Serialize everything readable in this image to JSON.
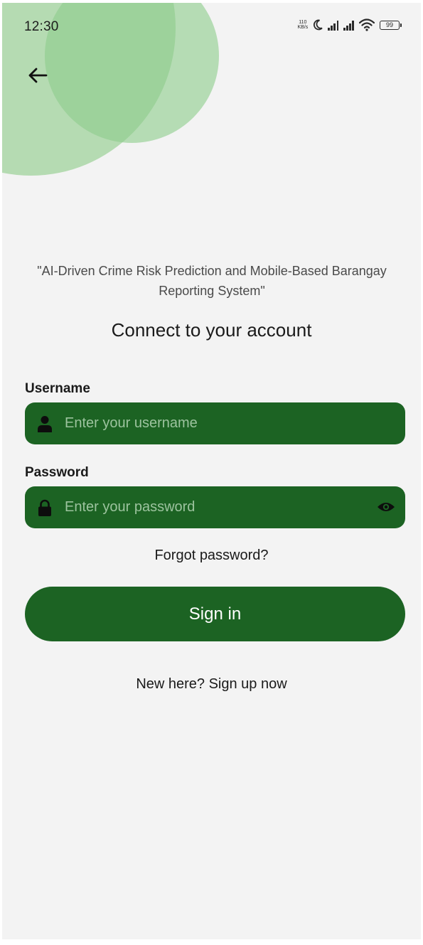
{
  "status_bar": {
    "time": "12:30",
    "network_speed_value": "110",
    "network_speed_unit": "KB/s",
    "battery_level": "99",
    "icons": [
      "moon-icon",
      "signal-icon",
      "signal-icon",
      "wifi-icon",
      "battery-icon"
    ]
  },
  "header": {
    "back_icon": "arrow-left-icon"
  },
  "tagline": "\"AI-Driven Crime Risk Prediction and Mobile-Based Barangay Reporting System\"",
  "title": "Connect to your account",
  "form": {
    "username": {
      "label": "Username",
      "placeholder": "Enter your username",
      "value": "",
      "icon": "person-icon"
    },
    "password": {
      "label": "Password",
      "placeholder": "Enter your password",
      "value": "",
      "icon": "lock-icon",
      "toggle_icon": "eye-icon"
    },
    "forgot_password": "Forgot password?",
    "sign_in": "Sign in",
    "signup_prompt": "New here? Sign up now"
  },
  "colors": {
    "primary": "#1c6323",
    "background": "#f3f3f3",
    "circle_light": "#b5dbb2",
    "circle_mid": "#8ecd8c",
    "placeholder": "#9cc39e"
  }
}
